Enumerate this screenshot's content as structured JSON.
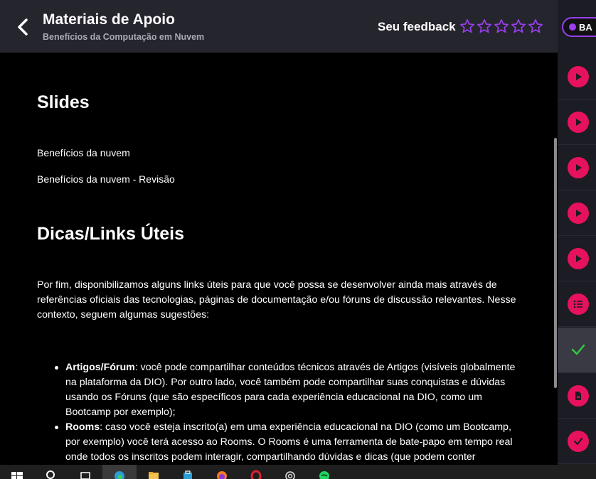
{
  "header": {
    "title": "Materiais de Apoio",
    "subtitle": "Benefícios da Computação em Nuvem",
    "feedback_label": "Seu feedback",
    "star_count": 5,
    "badge_label": "BA"
  },
  "content": {
    "slides_heading": "Slides",
    "slide_links": [
      "Benefícios da nuvem",
      "Benefícios da nuvem - Revisão"
    ],
    "links_heading": "Dicas/Links Úteis",
    "intro_paragraph": "Por fim, disponibilizamos alguns links úteis para que você possa se desenvolver ainda mais através de referências oficiais das tecnologias, páginas de documentação e/ou fóruns de discussão relevantes. Nesse contexto, seguem algumas sugestões:",
    "list": [
      {
        "term": "Artigos/Fórum",
        "text": ": você pode compartilhar conteúdos técnicos através de Artigos (visíveis globalmente na plataforma da DIO). Por outro lado, você também pode compartilhar suas conquistas e dúvidas usando os Fóruns (que são específicos para cada experiência educacional na DIO, como um Bootcamp por exemplo);"
      },
      {
        "term": "Rooms",
        "text": ": caso você esteja inscrito(a) em uma experiência educacional na DIO (como um Bootcamp, por exemplo) você terá acesso ao Rooms. O Rooms é uma ferramenta de bate-papo em tempo real onde todos os inscritos podem interagir, compartilhando dúvidas e dicas (que podem conter"
      }
    ]
  },
  "sidebar": {
    "items": [
      {
        "icon": "play-icon",
        "state": "normal"
      },
      {
        "icon": "play-icon",
        "state": "normal"
      },
      {
        "icon": "play-icon",
        "state": "normal"
      },
      {
        "icon": "play-icon",
        "state": "normal"
      },
      {
        "icon": "play-icon",
        "state": "normal"
      },
      {
        "icon": "list-icon",
        "state": "normal"
      },
      {
        "icon": "check-icon",
        "state": "active"
      },
      {
        "icon": "document-icon",
        "state": "normal"
      },
      {
        "icon": "check-icon",
        "state": "normal"
      }
    ]
  },
  "taskbar": {
    "apps": [
      "windows-start-icon",
      "search-icon",
      "task-view-icon",
      "edge-icon",
      "file-explorer-icon",
      "store-icon",
      "firefox-icon",
      "opera-icon",
      "chatgpt-icon",
      "spotify-icon"
    ],
    "active_app": "edge-icon"
  },
  "colors": {
    "accent_pink": "#e6125e",
    "accent_purple": "#9b3ff0",
    "check_green": "#2ecc40",
    "header_bg": "#25252e",
    "sidebar_bg": "#1c1c24"
  }
}
